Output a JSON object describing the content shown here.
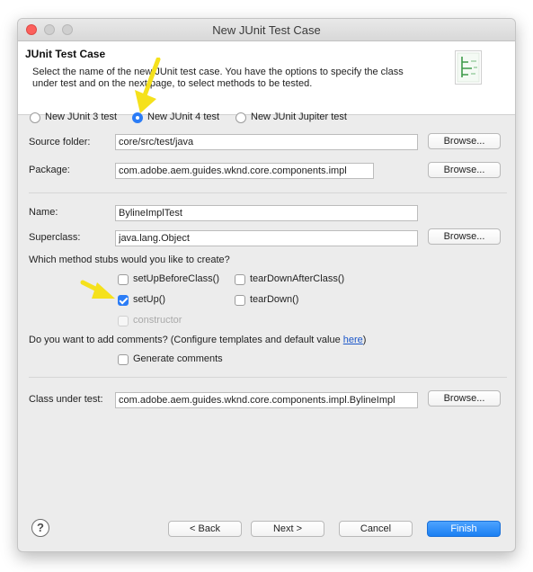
{
  "window": {
    "title": "New JUnit Test Case"
  },
  "header": {
    "title": "JUnit Test Case",
    "description": "Select the name of the new JUnit test case. You have the options to specify the class under test and on the next page, to select methods to be tested."
  },
  "junit_version": {
    "options": [
      "New JUnit 3 test",
      "New JUnit 4 test",
      "New JUnit Jupiter test"
    ],
    "selected": "New JUnit 4 test"
  },
  "form": {
    "source_folder": {
      "label": "Source folder:",
      "value": "core/src/test/java",
      "button": "Browse..."
    },
    "package": {
      "label": "Package:",
      "value": "com.adobe.aem.guides.wknd.core.components.impl",
      "button": "Browse..."
    },
    "name": {
      "label": "Name:",
      "value": "BylineImplTest"
    },
    "superclass": {
      "label": "Superclass:",
      "value": "java.lang.Object",
      "button": "Browse..."
    },
    "class_under_test": {
      "label": "Class under test:",
      "value": "com.adobe.aem.guides.wknd.core.components.impl.BylineImpl",
      "button": "Browse..."
    }
  },
  "stubs": {
    "question": "Which method stubs would you like to create?",
    "setUpBeforeClass": {
      "label": "setUpBeforeClass()",
      "checked": false
    },
    "tearDownAfterClass": {
      "label": "tearDownAfterClass()",
      "checked": false
    },
    "setUp": {
      "label": "setUp()",
      "checked": true
    },
    "tearDown": {
      "label": "tearDown()",
      "checked": false
    },
    "constructor": {
      "label": "constructor",
      "checked": false,
      "disabled": true
    }
  },
  "comments": {
    "question": "Do you want to add comments? (Configure templates and default value ",
    "link": "here",
    "question_end": ")",
    "generate": {
      "label": "Generate comments",
      "checked": false
    }
  },
  "footer": {
    "help": "?",
    "back": "< Back",
    "next": "Next >",
    "cancel": "Cancel",
    "finish": "Finish"
  },
  "colors": {
    "accent": "#2b7cf6",
    "annotation_arrow": "#f5e11c",
    "link": "#1a56c9"
  }
}
